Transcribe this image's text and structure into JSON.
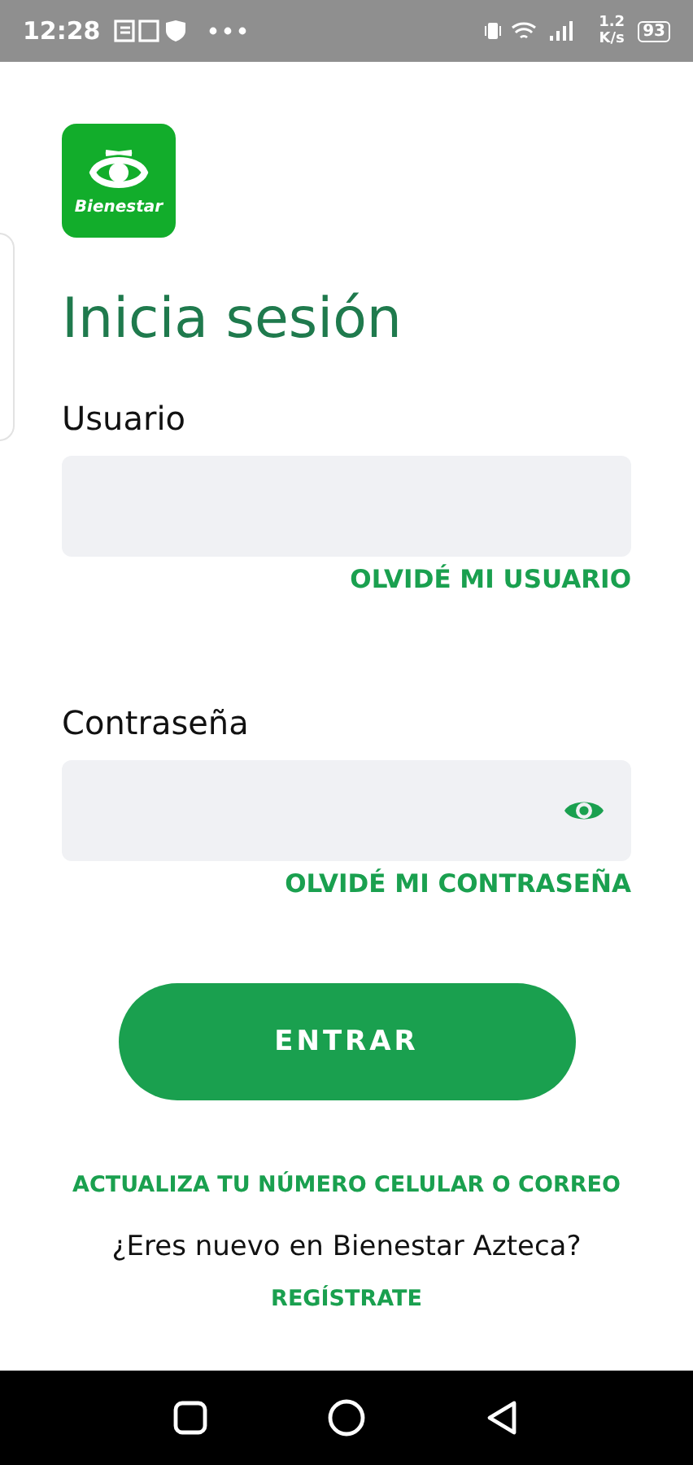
{
  "status_bar": {
    "time": "12:28",
    "speed": "1.2",
    "speed_unit": "K/s",
    "battery": "93"
  },
  "logo": {
    "text": "Bienestar"
  },
  "title": "Inicia sesión",
  "fields": [
    {
      "label": "Usuario",
      "kind": "text",
      "link": "OLVIDÉ MI USUARIO"
    },
    {
      "label": "Contraseña",
      "kind": "password",
      "link": "OLVIDÉ MI CONTRASEÑA"
    }
  ],
  "submit": "ENTRAR",
  "update_link": "ACTUALIZA TU NÚMERO CELULAR O CORREO",
  "new_prompt": "¿Eres nuevo en Bienestar Azteca?",
  "register_link": "REGÍSTRATE"
}
